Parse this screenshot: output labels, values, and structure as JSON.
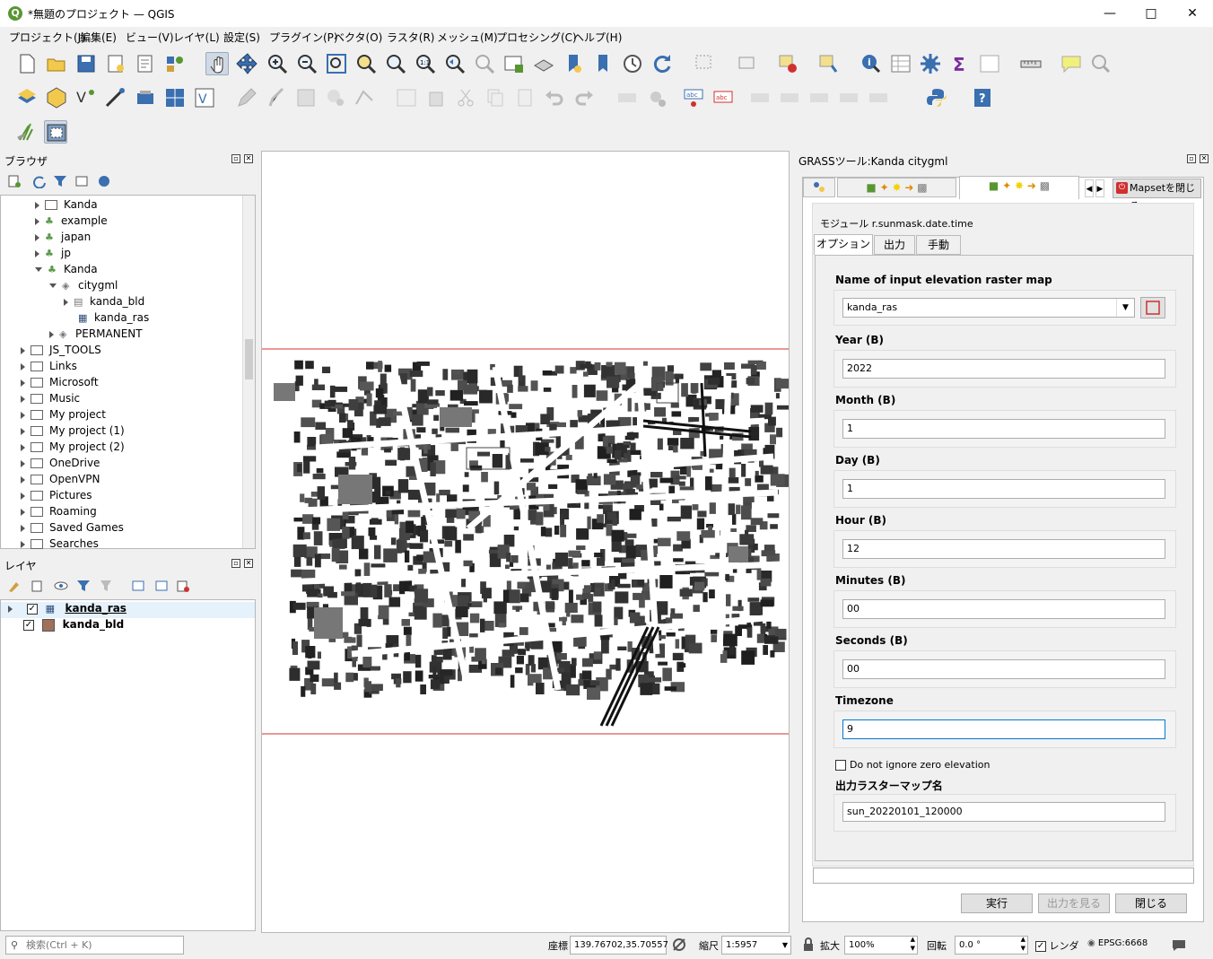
{
  "window": {
    "title": "*無題のプロジェクト — QGIS"
  },
  "menu": [
    "プロジェクト(J)",
    "編集(E)",
    "ビュー(V)",
    "レイヤ(L)",
    "設定(S)",
    "プラグイン(P)",
    "ベクタ(O)",
    "ラスタ(R)",
    "メッシュ(M)",
    "プロセシング(C)",
    "ヘルプ(H)"
  ],
  "browser": {
    "title": "ブラウザ",
    "items": [
      "Kanda",
      "example",
      "japan",
      "jp",
      "Kanda",
      "citygml",
      "kanda_bld",
      "kanda_ras",
      "PERMANENT",
      "JS_TOOLS",
      "Links",
      "Microsoft",
      "Music",
      "My project",
      "My project (1)",
      "My project (2)",
      "OneDrive",
      "OpenVPN",
      "Pictures",
      "Roaming",
      "Saved Games",
      "Searches"
    ]
  },
  "layers": {
    "title": "レイヤ",
    "items": [
      "kanda_ras",
      "kanda_bld"
    ]
  },
  "grass": {
    "title": "GRASSツール:Kanda citygml",
    "close_mapset": "Mapsetを閉じる",
    "module": "モジュール r.sunmask.date.time",
    "tabs": [
      "オプション",
      "出力",
      "手動"
    ],
    "fields": {
      "elev_label": "Name of input elevation raster map",
      "elev_value": "kanda_ras",
      "year_label": "Year (B)",
      "year_value": "2022",
      "month_label": "Month (B)",
      "month_value": "1",
      "day_label": "Day (B)",
      "day_value": "1",
      "hour_label": "Hour (B)",
      "hour_value": "12",
      "minutes_label": "Minutes (B)",
      "minutes_value": "00",
      "seconds_label": "Seconds (B)",
      "seconds_value": "00",
      "timezone_label": "Timezone",
      "timezone_value": "9",
      "zero_label": "Do not ignore zero elevation",
      "output_label": "出力ラスターマップ名",
      "output_value": "sun_20220101_120000"
    },
    "buttons": {
      "run": "実行",
      "view": "出力を見る",
      "close": "閉じる"
    }
  },
  "statusbar": {
    "search_placeholder": "検索(Ctrl + K)",
    "coord_label": "座標",
    "coord_value": "139.76702,35.70557",
    "scale_label": "縮尺",
    "scale_value": "1:5957",
    "mag_label": "拡大",
    "mag_value": "100%",
    "rot_label": "回転",
    "rot_value": "0.0 °",
    "render_label": "レンダ",
    "crs": "EPSG:6668"
  },
  "colors": {
    "accent": "#589632",
    "map_bound": "#d03030",
    "bld_swatch": "#a0705a"
  }
}
